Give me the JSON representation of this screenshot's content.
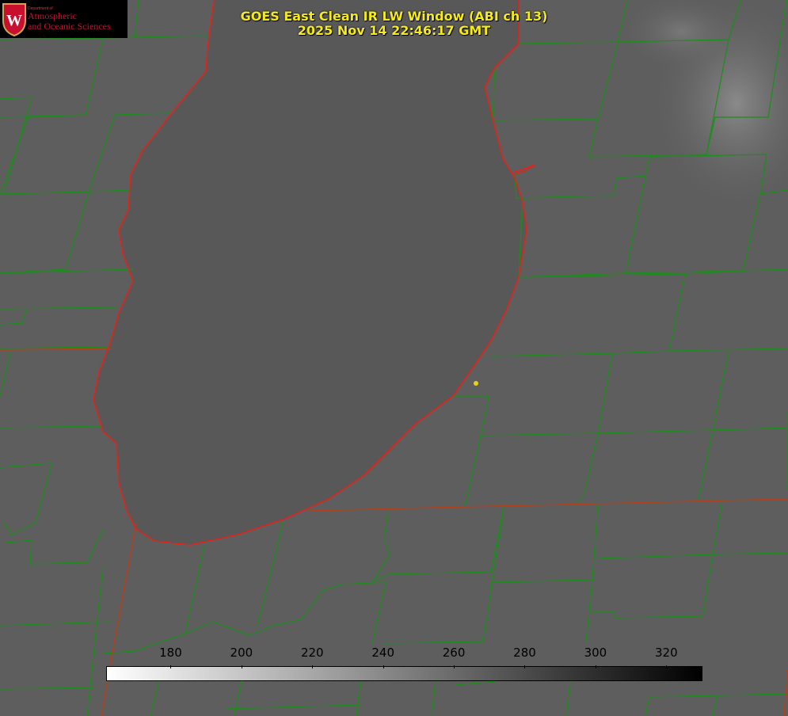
{
  "title": {
    "line1": "GOES East Clean IR LW Window (ABI ch 13)",
    "line2": "2025 Nov 14 22:46:17 GMT"
  },
  "logo": {
    "department": "Department of",
    "line1": "Atmospheric",
    "line2": "and Oceanic Sciences",
    "shield_letter": "W"
  },
  "colorbar": {
    "min_value": 162,
    "max_value": 330,
    "ticks": [
      180,
      200,
      220,
      240,
      260,
      280,
      300,
      320
    ],
    "colors": {
      "low": "#ffffff",
      "high": "#000000"
    }
  },
  "colors": {
    "county_lines": "#1a8f1a",
    "coastline": "#e0241a",
    "title_text": "#f5ea1c",
    "marker": "#e6d21a"
  }
}
